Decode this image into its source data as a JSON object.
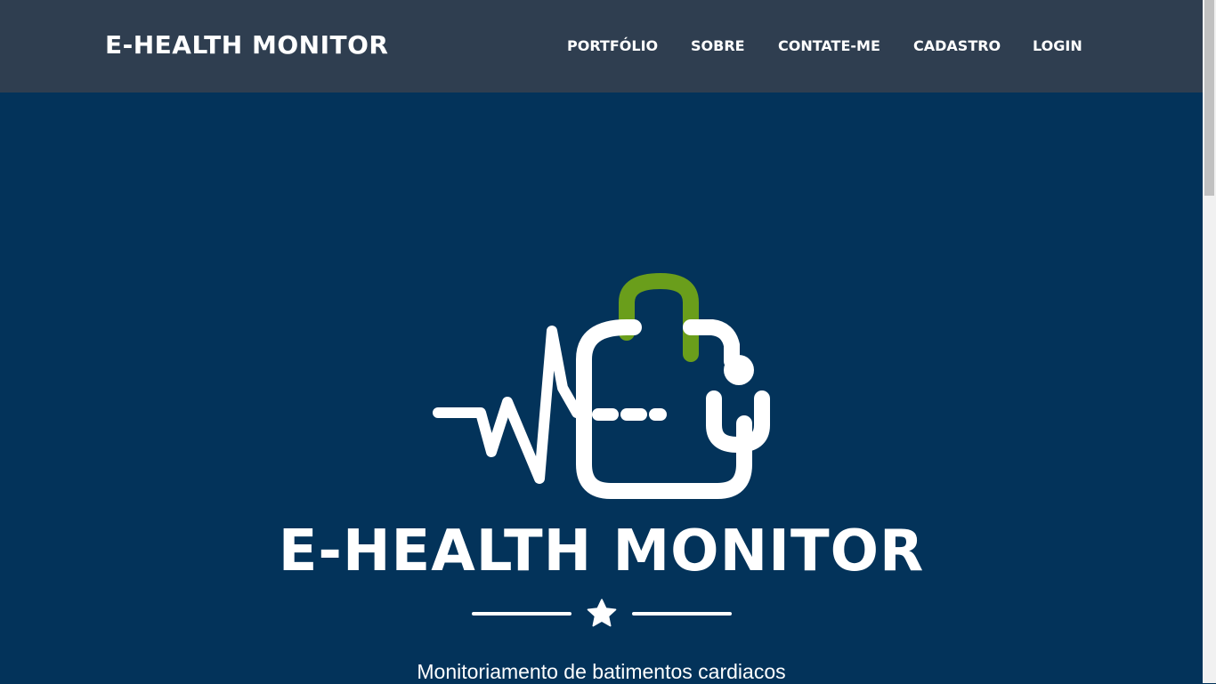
{
  "navbar": {
    "brand": "E-HEALTH MONITOR",
    "links": [
      {
        "label": "PORTFÓLIO"
      },
      {
        "label": "SOBRE"
      },
      {
        "label": "CONTATE-ME"
      },
      {
        "label": "CADASTRO"
      },
      {
        "label": "LOGIN"
      }
    ]
  },
  "hero": {
    "logo_icon": "medical-bag-heartbeat-icon",
    "title": "E-HEALTH MONITOR",
    "divider_icon": "star-icon",
    "subtitle": "Monitoriamento de batimentos cardiacos"
  },
  "colors": {
    "navbar_bg": "#2f3e50",
    "hero_bg": "#03335a",
    "logo_accent": "#6a9e1b",
    "text": "#ffffff"
  }
}
